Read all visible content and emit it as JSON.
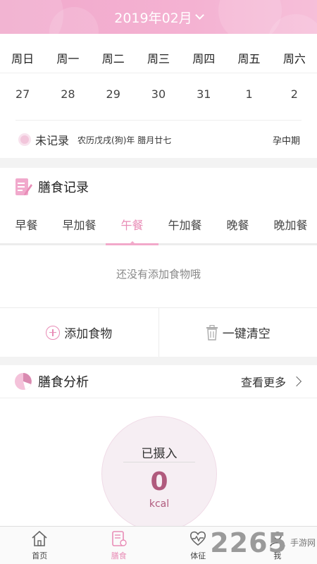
{
  "header": {
    "month": "2019年02月"
  },
  "calendar": {
    "weekdays": [
      "周日",
      "周一",
      "周二",
      "周三",
      "周四",
      "周五",
      "周六"
    ],
    "dates": [
      "27",
      "28",
      "29",
      "30",
      "31",
      "1",
      "2"
    ],
    "status": "未记录",
    "lunar": "农历戊戌(狗)年 腊月廿七",
    "stage": "孕中期"
  },
  "diet": {
    "title": "膳食记录",
    "tabs": [
      "早餐",
      "早加餐",
      "午餐",
      "午加餐",
      "晚餐",
      "晚加餐"
    ],
    "active_tab": "午餐",
    "empty_message": "还没有添加食物哦",
    "add_label": "添加食物",
    "clear_label": "一键清空"
  },
  "analysis": {
    "title": "膳食分析",
    "more_label": "查看更多",
    "intake_label": "已摄入",
    "intake_value": "0",
    "intake_unit": "kcal"
  },
  "tabbar": {
    "items": [
      "首页",
      "膳食",
      "体征",
      "我"
    ],
    "active": "膳食"
  },
  "watermark": {
    "text": "2265",
    "side": "手游网"
  },
  "colors": {
    "accent": "#e88cb6",
    "header": "#f1a9cc",
    "value": "#b05a7d"
  }
}
